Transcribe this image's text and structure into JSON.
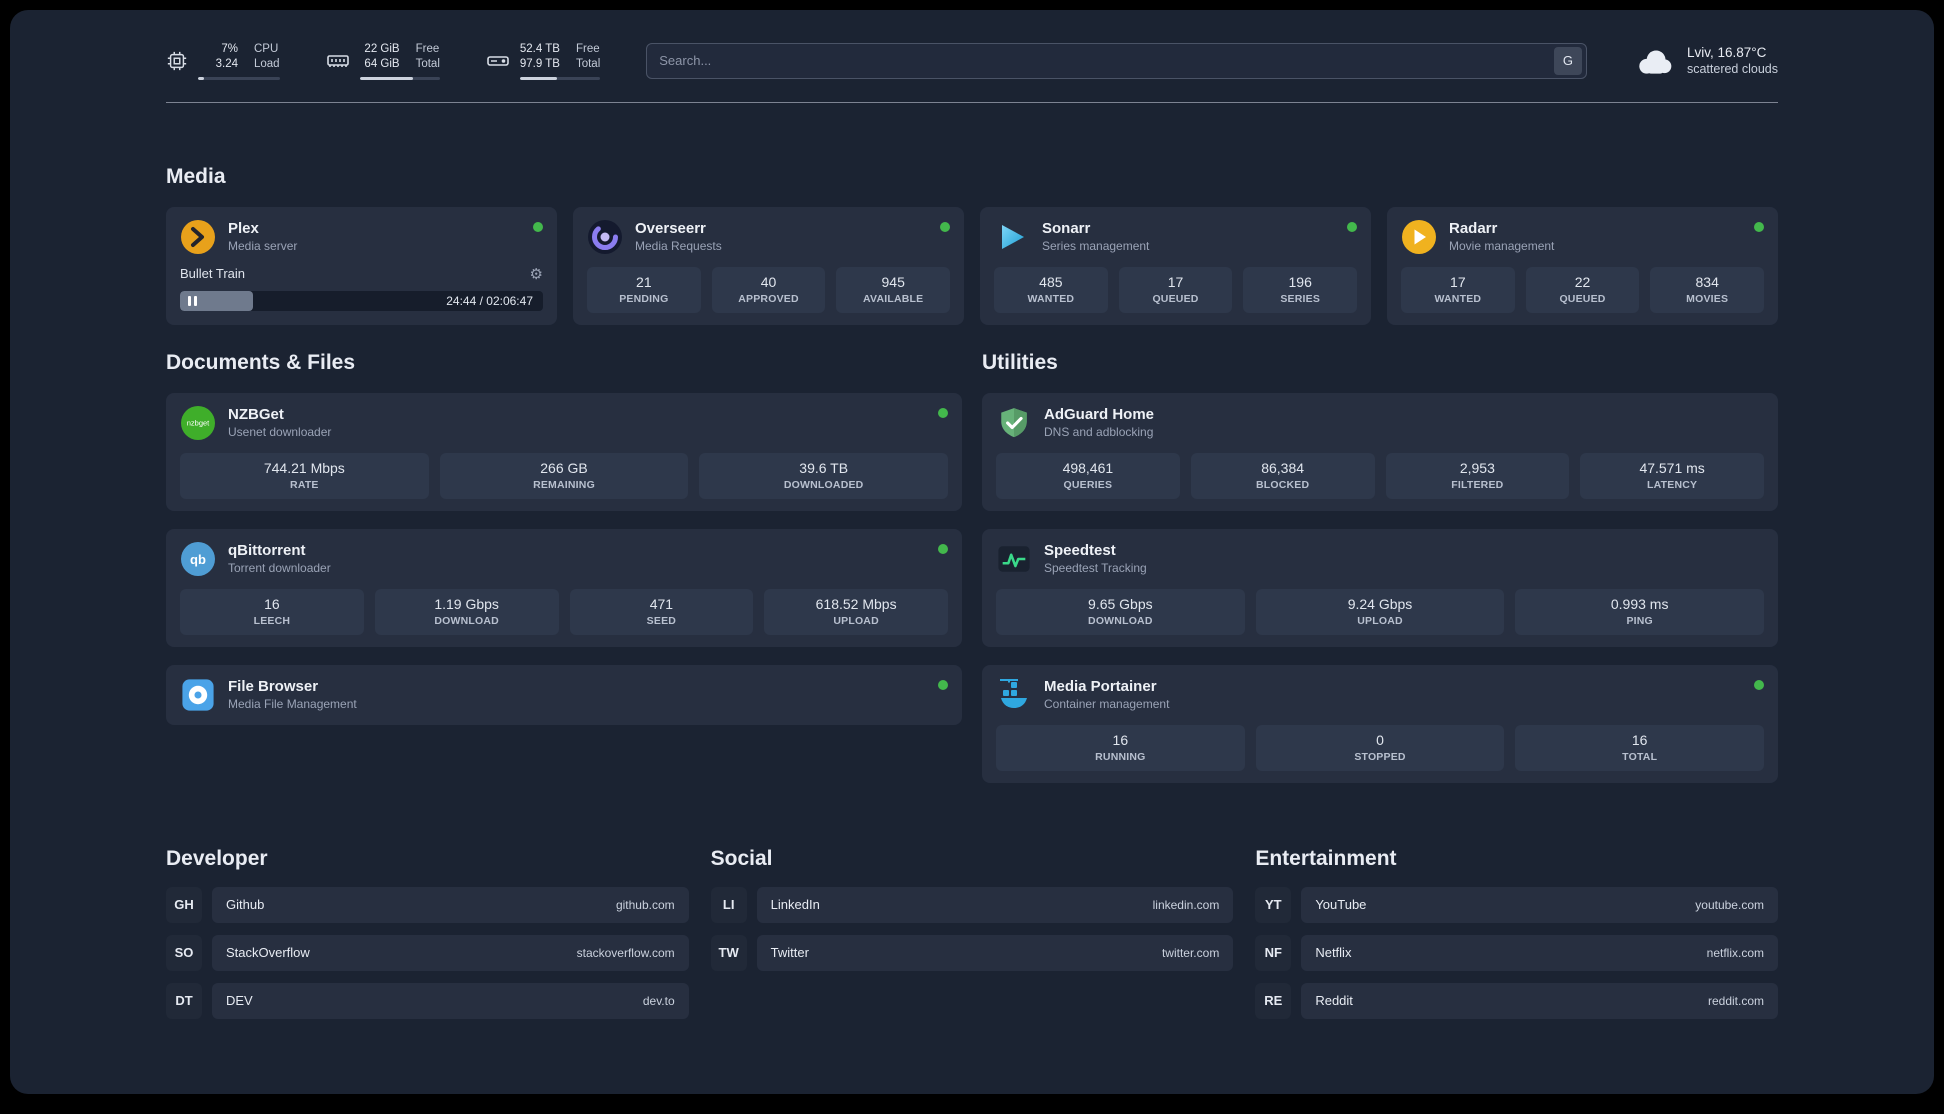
{
  "theme": {
    "page_bg": "#1b2332",
    "card_bg": "#272f40",
    "tile_bg": "#2e384b",
    "status_online": "#43b84c",
    "plex_brand": "#e8a11b",
    "sonarr_brand": "#3fc1f3",
    "radarr_brand": "#f0b21f",
    "nzbget_brand": "#3fae2a",
    "qbittorrent_brand": "#4f9dd4",
    "adguard_brand": "#67b279",
    "speedtest_graph": "#3ad98a",
    "portainer_brand": "#2fa8e0",
    "filebrowser_brand": "#4aa3e8"
  },
  "header": {
    "cpu": {
      "value1": "7%",
      "value2": "3.24",
      "label1": "CPU",
      "label2": "Load",
      "progress_pct": 7
    },
    "memory": {
      "value1": "22 GiB",
      "value2": "64 GiB",
      "label1": "Free",
      "label2": "Total",
      "progress_pct": 66
    },
    "disk": {
      "value1": "52.4 TB",
      "value2": "97.9 TB",
      "label1": "Free",
      "label2": "Total",
      "progress_pct": 46
    },
    "search": {
      "placeholder": "Search...",
      "engine_button": "G"
    },
    "weather": {
      "location": "Lviv, 16.87°C",
      "condition": "scattered clouds"
    }
  },
  "sections": {
    "media": {
      "title": "Media"
    },
    "documents": {
      "title": "Documents & Files"
    },
    "utilities": {
      "title": "Utilities"
    },
    "developer": {
      "title": "Developer"
    },
    "social": {
      "title": "Social"
    },
    "entertainment": {
      "title": "Entertainment"
    }
  },
  "apps": {
    "plex": {
      "name": "Plex",
      "subtitle": "Media server",
      "now_playing": "Bullet Train",
      "time": "24:44 / 02:06:47",
      "progress_pct": 20,
      "gear_icon": "⚙"
    },
    "overseerr": {
      "name": "Overseerr",
      "subtitle": "Media Requests",
      "stats": [
        {
          "value": "21",
          "label": "PENDING"
        },
        {
          "value": "40",
          "label": "APPROVED"
        },
        {
          "value": "945",
          "label": "AVAILABLE"
        }
      ]
    },
    "sonarr": {
      "name": "Sonarr",
      "subtitle": "Series management",
      "stats": [
        {
          "value": "485",
          "label": "WANTED"
        },
        {
          "value": "17",
          "label": "QUEUED"
        },
        {
          "value": "196",
          "label": "SERIES"
        }
      ]
    },
    "radarr": {
      "name": "Radarr",
      "subtitle": "Movie management",
      "stats": [
        {
          "value": "17",
          "label": "WANTED"
        },
        {
          "value": "22",
          "label": "QUEUED"
        },
        {
          "value": "834",
          "label": "MOVIES"
        }
      ]
    },
    "nzbget": {
      "name": "NZBGet",
      "subtitle": "Usenet downloader",
      "stats": [
        {
          "value": "744.21 Mbps",
          "label": "RATE"
        },
        {
          "value": "266 GB",
          "label": "REMAINING"
        },
        {
          "value": "39.6 TB",
          "label": "DOWNLOADED"
        }
      ]
    },
    "qbittorrent": {
      "name": "qBittorrent",
      "subtitle": "Torrent downloader",
      "stats": [
        {
          "value": "16",
          "label": "LEECH"
        },
        {
          "value": "1.19 Gbps",
          "label": "DOWNLOAD"
        },
        {
          "value": "471",
          "label": "SEED"
        },
        {
          "value": "618.52 Mbps",
          "label": "UPLOAD"
        }
      ]
    },
    "filebrowser": {
      "name": "File Browser",
      "subtitle": "Media File Management"
    },
    "adguard": {
      "name": "AdGuard Home",
      "subtitle": "DNS and adblocking",
      "stats": [
        {
          "value": "498,461",
          "label": "QUERIES"
        },
        {
          "value": "86,384",
          "label": "BLOCKED"
        },
        {
          "value": "2,953",
          "label": "FILTERED"
        },
        {
          "value": "47.571 ms",
          "label": "LATENCY"
        }
      ]
    },
    "speedtest": {
      "name": "Speedtest",
      "subtitle": "Speedtest Tracking",
      "stats": [
        {
          "value": "9.65 Gbps",
          "label": "DOWNLOAD"
        },
        {
          "value": "9.24 Gbps",
          "label": "UPLOAD"
        },
        {
          "value": "0.993 ms",
          "label": "PING"
        }
      ]
    },
    "portainer": {
      "name": "Media Portainer",
      "subtitle": "Container management",
      "stats": [
        {
          "value": "16",
          "label": "RUNNING"
        },
        {
          "value": "0",
          "label": "STOPPED"
        },
        {
          "value": "16",
          "label": "TOTAL"
        }
      ]
    }
  },
  "bookmarks": {
    "developer": [
      {
        "abbr": "GH",
        "name": "Github",
        "url": "github.com"
      },
      {
        "abbr": "SO",
        "name": "StackOverflow",
        "url": "stackoverflow.com"
      },
      {
        "abbr": "DT",
        "name": "DEV",
        "url": "dev.to"
      }
    ],
    "social": [
      {
        "abbr": "LI",
        "name": "LinkedIn",
        "url": "linkedin.com"
      },
      {
        "abbr": "TW",
        "name": "Twitter",
        "url": "twitter.com"
      }
    ],
    "entertainment": [
      {
        "abbr": "YT",
        "name": "YouTube",
        "url": "youtube.com"
      },
      {
        "abbr": "NF",
        "name": "Netflix",
        "url": "netflix.com"
      },
      {
        "abbr": "RE",
        "name": "Reddit",
        "url": "reddit.com"
      }
    ]
  }
}
